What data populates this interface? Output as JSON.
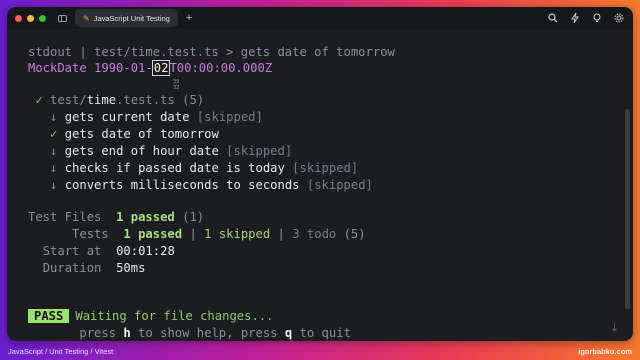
{
  "window": {
    "tab_title": "JavaScript Unit Testing",
    "tab_icon": "pencil-icon",
    "traffic_lights": [
      "#ff5f57",
      "#febc2e",
      "#28c840"
    ]
  },
  "terminal": {
    "stdout_line": "stdout | test/time.test.ts > gets date of tomorrow",
    "mock_prefix": "MockDate 1990-01-",
    "mock_cursor": "02",
    "mock_suffix": "T00:00:00.000Z",
    "cursor_hint": "39\n32",
    "suite_check": "✓",
    "suite_path_dir": "test/",
    "suite_path_file": "time",
    "suite_path_ext": ".test.ts",
    "suite_count": "(5)",
    "tests": [
      {
        "mark": "↓",
        "name": "gets current date",
        "status": "[skipped]"
      },
      {
        "mark": "✓",
        "name": "gets date of tomorrow",
        "status": ""
      },
      {
        "mark": "↓",
        "name": "gets end of hour date",
        "status": "[skipped]"
      },
      {
        "mark": "↓",
        "name": "checks if passed date is today",
        "status": "[skipped]"
      },
      {
        "mark": "↓",
        "name": "converts milliseconds to seconds",
        "status": "[skipped]"
      }
    ],
    "summary": {
      "test_files_label": "Test Files",
      "test_files_passed": "1 passed",
      "test_files_total": "(1)",
      "tests_label": "Tests",
      "tests_passed": "1 passed",
      "tests_sep1": "|",
      "tests_skipped": "1 skipped",
      "tests_sep2": "|",
      "tests_todo": "3 todo",
      "tests_total": "(5)",
      "start_label": "Start at",
      "start_value": "00:01:28",
      "duration_label": "Duration",
      "duration_value": "50ms"
    },
    "watch": {
      "badge": "PASS",
      "message": "Waiting for file changes...",
      "help_press": "press",
      "help_key_h": "h",
      "help_mid": "to show help, press",
      "help_key_q": "q",
      "help_end": "to quit"
    }
  },
  "footer": {
    "left": "JavaScript / Unit Testing / Vitest",
    "right": "igorbabko.com"
  }
}
